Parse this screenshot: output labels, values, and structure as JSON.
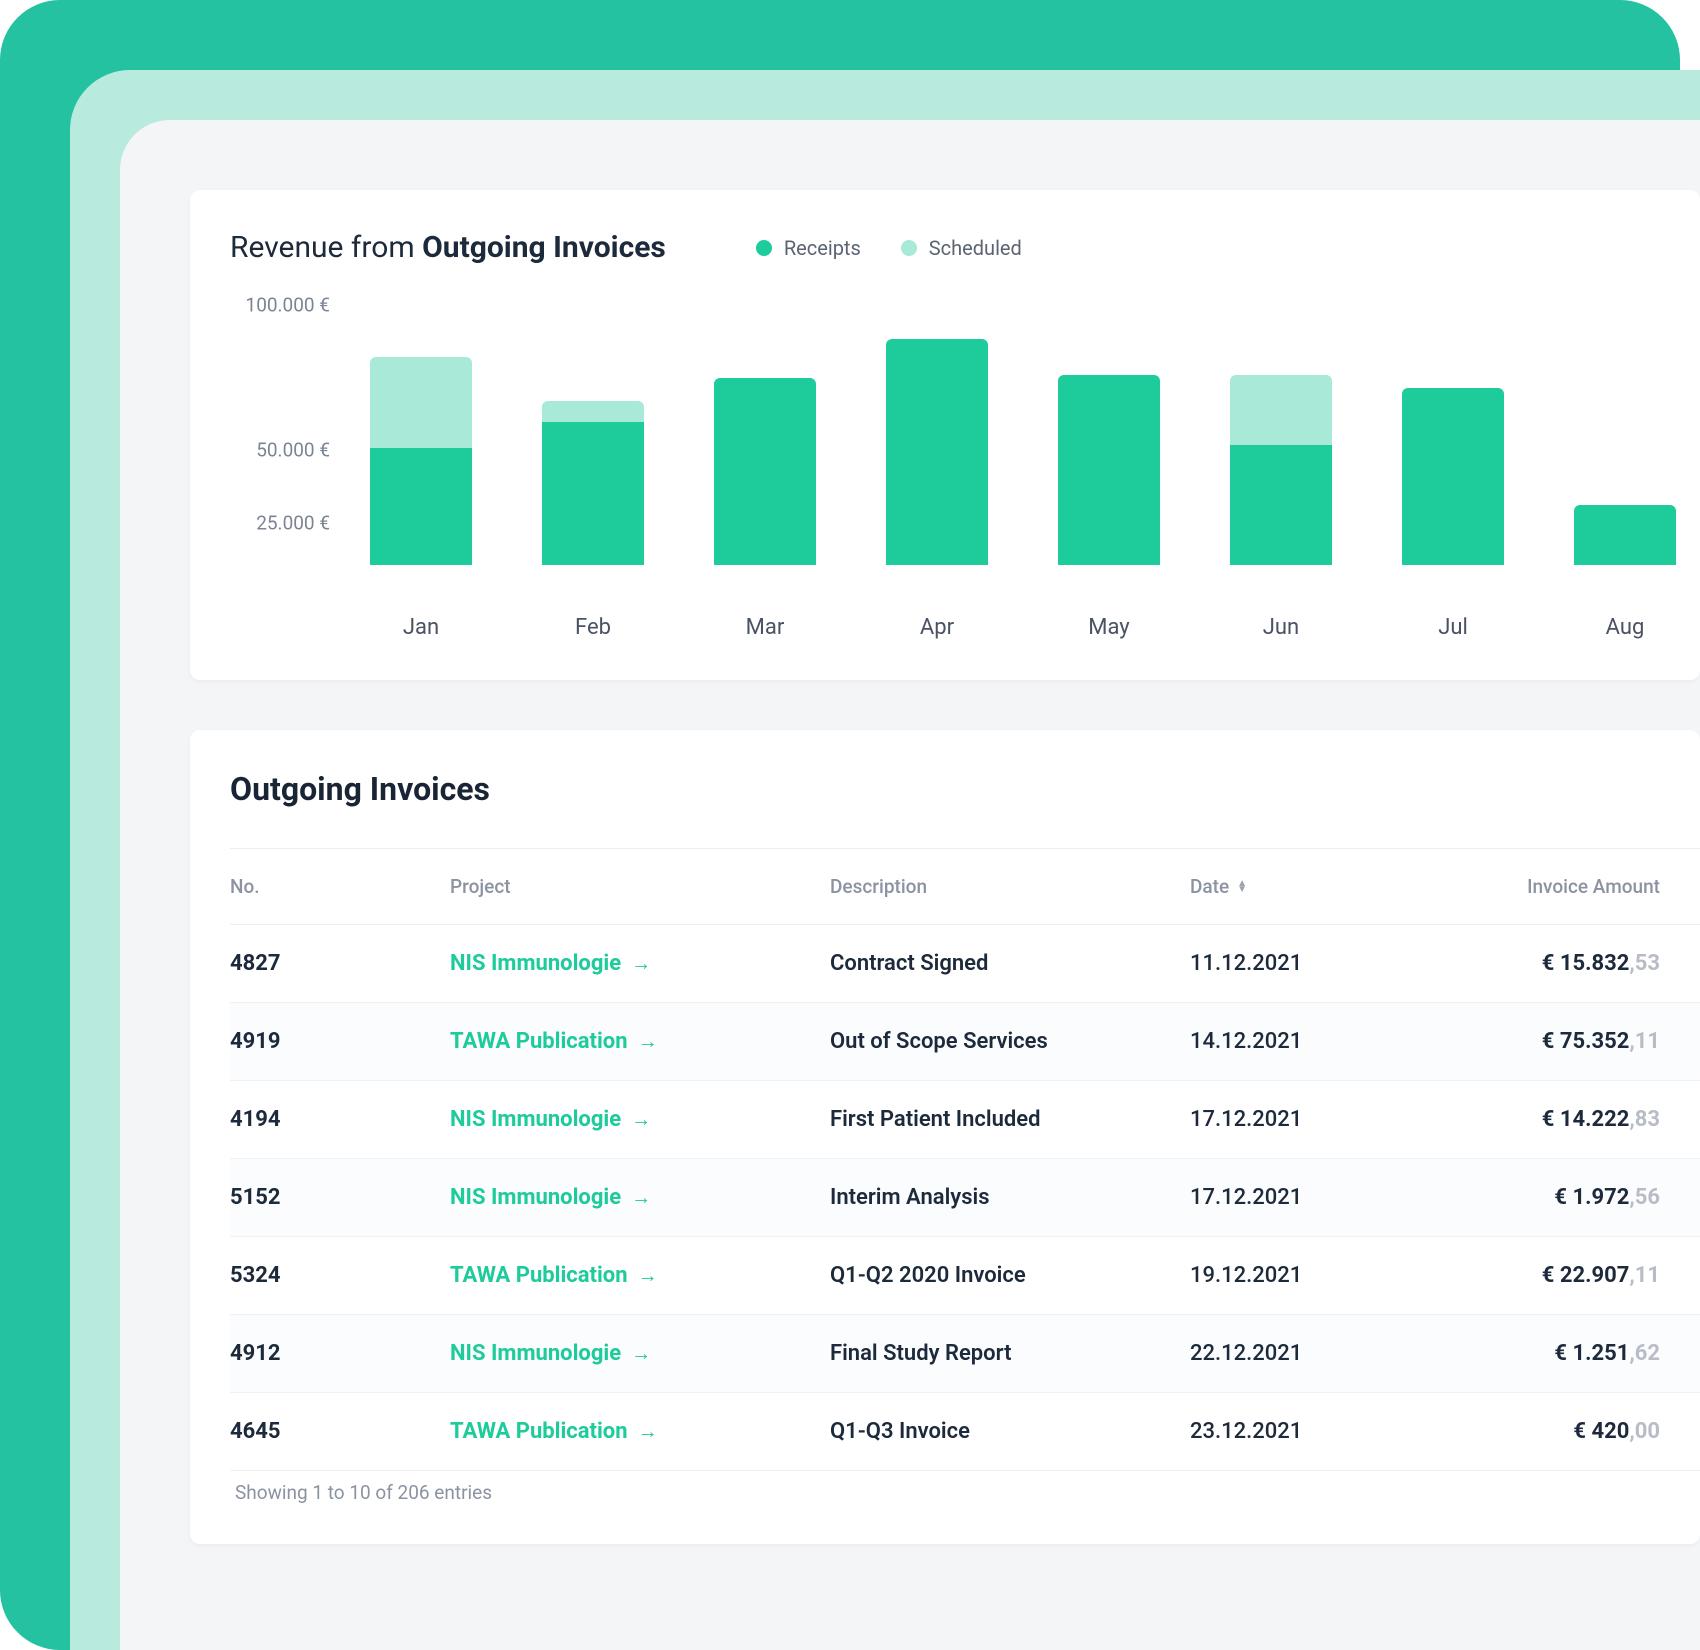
{
  "colors": {
    "accent": "#1dcb9b",
    "accentLight": "#a8e9d7"
  },
  "chart": {
    "title_prefix": "Revenue from ",
    "title_bold": "Outgoing Invoices",
    "legend": {
      "receipts": "Receipts",
      "scheduled": "Scheduled"
    },
    "y_ticks": [
      "100.000 €",
      "50.000 €",
      "25.000 €"
    ]
  },
  "chart_data": {
    "type": "bar",
    "categories": [
      "Jan",
      "Feb",
      "Mar",
      "Apr",
      "May",
      "Jun",
      "Jul",
      "Aug"
    ],
    "series": [
      {
        "name": "Receipts",
        "values": [
          45000,
          55000,
          72000,
          87000,
          73000,
          46000,
          68000,
          23000
        ]
      },
      {
        "name": "Scheduled",
        "values": [
          35000,
          8000,
          0,
          0,
          0,
          27000,
          0,
          0
        ]
      }
    ],
    "ylabel": "€",
    "ylim": [
      0,
      100000
    ],
    "title": "Revenue from Outgoing Invoices"
  },
  "invoices": {
    "title": "Outgoing Invoices",
    "columns": {
      "no": "No.",
      "project": "Project",
      "description": "Description",
      "date": "Date",
      "amount": "Invoice Amount"
    },
    "rows": [
      {
        "no": "4827",
        "project": "NIS Immunologie",
        "description": "Contract Signed",
        "date": "11.12.2021",
        "amount_main": "€ 15.832",
        "amount_cents": ",53"
      },
      {
        "no": "4919",
        "project": "TAWA Publication",
        "description": "Out of Scope Services",
        "date": "14.12.2021",
        "amount_main": "€ 75.352",
        "amount_cents": ",11"
      },
      {
        "no": "4194",
        "project": "NIS Immunologie",
        "description": "First Patient Included",
        "date": "17.12.2021",
        "amount_main": "€ 14.222",
        "amount_cents": ",83"
      },
      {
        "no": "5152",
        "project": "NIS Immunologie",
        "description": "Interim Analysis",
        "date": "17.12.2021",
        "amount_main": "€ 1.972",
        "amount_cents": ",56"
      },
      {
        "no": "5324",
        "project": "TAWA Publication",
        "description": "Q1-Q2 2020 Invoice",
        "date": "19.12.2021",
        "amount_main": "€ 22.907",
        "amount_cents": ",11"
      },
      {
        "no": "4912",
        "project": "NIS Immunologie",
        "description": "Final Study Report",
        "date": "22.12.2021",
        "amount_main": "€ 1.251",
        "amount_cents": ",62"
      },
      {
        "no": "4645",
        "project": "TAWA Publication",
        "description": "Q1-Q3 Invoice",
        "date": "23.12.2021",
        "amount_main": "€ 420",
        "amount_cents": ",00"
      }
    ],
    "footer": "Showing 1 to 10 of 206 entries"
  }
}
